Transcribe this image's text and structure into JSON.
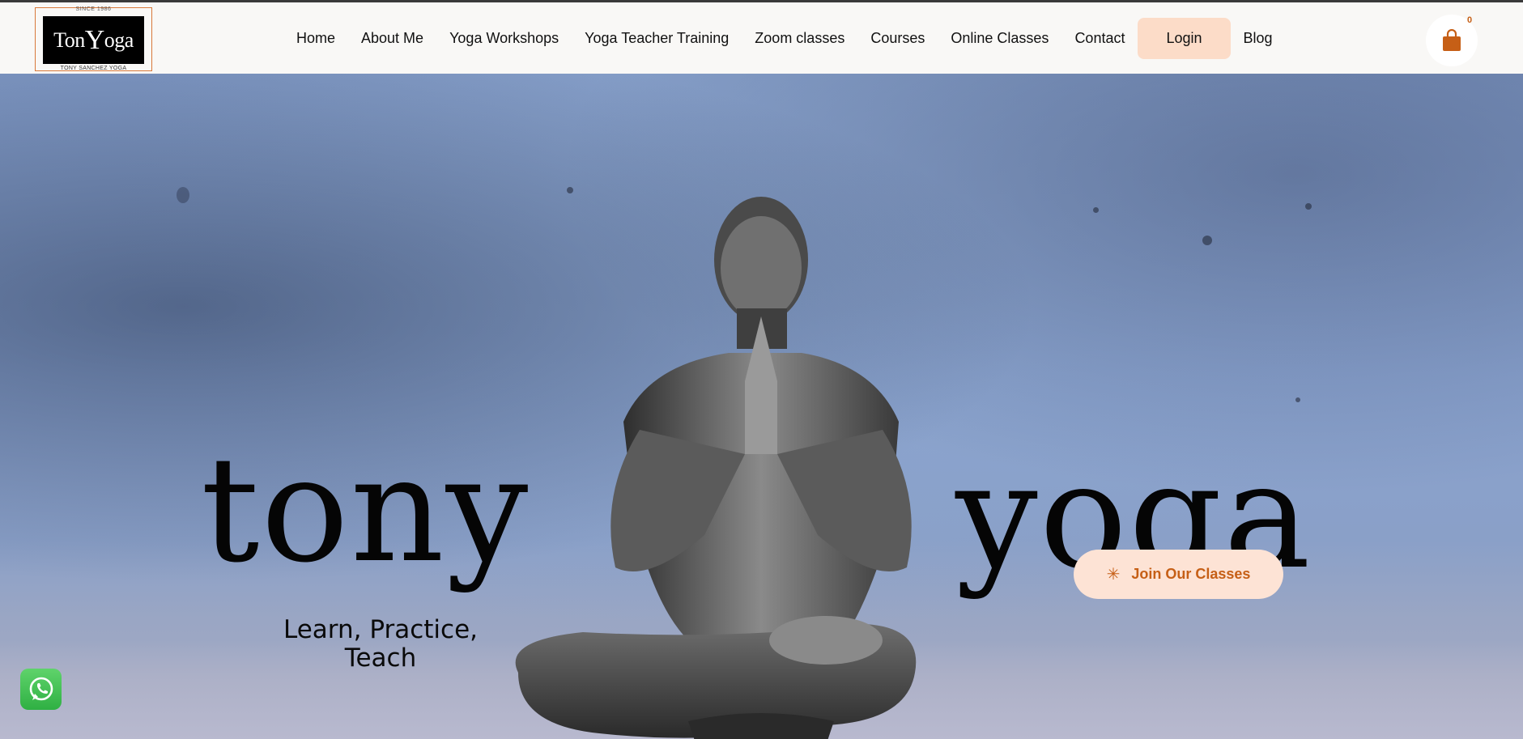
{
  "header": {
    "logo": {
      "since": "SINCE 1986",
      "wordmark_a": "Ton",
      "wordmark_b": "Y",
      "wordmark_c": "oga",
      "subtitle": "TONY SANCHEZ YOGA"
    },
    "nav": [
      {
        "label": "Home"
      },
      {
        "label": "About Me"
      },
      {
        "label": "Yoga Workshops"
      },
      {
        "label": "Yoga Teacher Training"
      },
      {
        "label": "Zoom classes"
      },
      {
        "label": "Courses"
      },
      {
        "label": "Online Classes"
      },
      {
        "label": "Contact"
      },
      {
        "label": "Login"
      },
      {
        "label": "Blog"
      }
    ],
    "cart": {
      "icon": "shopping-bag-icon",
      "count": "0"
    }
  },
  "hero": {
    "title_left": "tony",
    "title_right": "yoga",
    "tagline_line1": "Learn, Practice,",
    "tagline_line2": "Teach",
    "cta_label": "Join Our Classes",
    "cta_icon": "sparkle-icon"
  },
  "floating": {
    "whatsapp_icon": "whatsapp-icon"
  },
  "colors": {
    "accent": "#c65f16",
    "button_bg": "#fcdcc8",
    "logo_border": "#d9793a"
  }
}
